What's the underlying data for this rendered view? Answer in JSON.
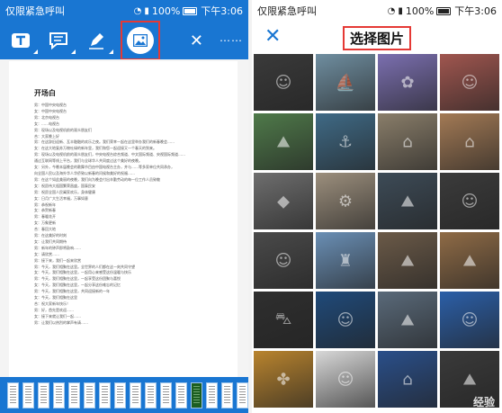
{
  "left": {
    "status": {
      "carrier": "仅限紧急呼叫",
      "battery": "100%",
      "time": "下午3:06"
    },
    "toolbar": {
      "tools": [
        "text-tool",
        "comment-tool",
        "pen-tool",
        "image-tool"
      ],
      "close_icon": "close-icon",
      "more_icon": "more-icon"
    },
    "document": {
      "title": "开场白",
      "lines": [
        "男：中国中央电视台",
        "女：中国中央电视台",
        "男：北京电视台",
        "女：……电视台",
        "男：现场以及电视机前的观众朋友们",
        "合：大家晚上好",
        "男：在这辞旧迎新、瓦丰融融的欢乐之夜。我们荣幸一起在这里举办我们的新春晚会……",
        "女：在这大地复苏万物吐绿的新年里，我们和您一起迎接又一个春天的到来。",
        "男：现场以及电视机前的观众朋友们，中央电视台综合频道、中文国际频道、央视国际频道……",
        "通过互联网等线上平台，我们与全球华人共同度过这个美好的夜晚。",
        "女：另外，今晚本届晚会的歌舞节目由中国电视台主办，并与……等多家单位共同承办，",
        "向全国人民以及海外华人华侨致以新春的问候和美好的祝福……",
        "男：在这个如此美丽的夜晚，我们向为晚会付出辛勤劳动的每一位工作人员致敬",
        "女：祝愿伟大祖国繁荣昌盛，国泰民安",
        "男：祝愿全国人民阖家欢乐，身体健康",
        "女：日月广大生活幸福，万事如意",
        "男：恭祝新年",
        "女：恭贺新春",
        "男：春暖花开",
        "女：万象更新",
        "合：春回大地",
        "男：在这美好的时刻",
        "女：让我们共同期待",
        "男：新年的钟声即将敲响……",
        "女：请欣赏……",
        "男：接下来，我们一起来欣赏",
        "男：今天，我们相聚在这里。全世界的人们都在这一刻共同守望",
        "女：今天，我们相聚在这里，一起用心来感受这份温暖与快乐",
        "男：今天，我们相聚在这里，一起享受这份团聚与喜悦",
        "女：今天，我们相聚在这里，一起分享这份难忘的记忆",
        "男：今天，我们相聚在这里，共同迎接新的一年",
        "女：今天，我们相聚在这里",
        "合：祝大家新年快乐！",
        "男：好，首先是欢迎……",
        "女：接下来就让我们一起……",
        "男：让我们以热烈的掌声有请……"
      ]
    },
    "thumbnail_count": 16,
    "active_thumbnail_index": 12
  },
  "right": {
    "status": {
      "carrier": "仅限紧急呼叫",
      "battery": "100%",
      "time": "下午3:06"
    },
    "title": "选择图片",
    "grid_colors": [
      [
        "#3a3a3a",
        "#6f8ea0",
        "#7b6fb0",
        "#a0564f"
      ],
      [
        "#4f7a4a",
        "#3f6a86",
        "#8a7e6a",
        "#a37a55"
      ],
      [
        "#6e6e6e",
        "#9c8f7d",
        "#3d4b57",
        "#3b3b3b"
      ],
      [
        "#4a4a4a",
        "#6a8fb5",
        "#6b5a48",
        "#8f6b46"
      ],
      [
        "#2f2f2f",
        "#1f4a7a",
        "#5a6a7a",
        "#2b5fa8"
      ],
      [
        "#b9842e",
        "#d8d8d8",
        "#2a4f8a",
        "#3a3a3a"
      ]
    ],
    "grid_icons": [
      [
        "person-icon",
        "boat-icon",
        "flower-icon",
        "person-icon"
      ],
      [
        "landscape-icon",
        "ship-icon",
        "building-icon",
        "building-icon"
      ],
      [
        "stone-icon",
        "gear-icon",
        "landscape-icon",
        "person-icon"
      ],
      [
        "person-icon",
        "castle-icon",
        "landscape-icon",
        "landscape-icon"
      ],
      [
        "car-icon",
        "person-icon",
        "landscape-icon",
        "person-icon"
      ],
      [
        "knot-icon",
        "person-icon",
        "palace-icon",
        "landscape-icon"
      ]
    ],
    "watermark": "经验"
  }
}
